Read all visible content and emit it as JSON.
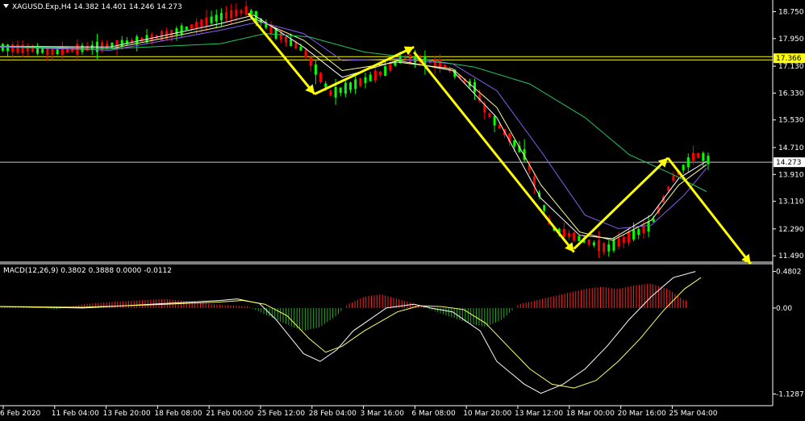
{
  "header": {
    "symbol_line": "XAGUSD.Exp,H4  14.382 14.401 14.246 14.273",
    "macd_line": "MACD(12,26,9) 0.3802 0.3888 0.0000 -0.0112"
  },
  "colors": {
    "background": "#000000",
    "bull_candle": "#00ff00",
    "bear_candle": "#ff0000",
    "arrow": "#ffff00",
    "ma_fast": "#ffffff",
    "ma_mid": "#ffff99",
    "ma_purple": "#8b5cf6",
    "ma_slow": "#22c55e",
    "macd_pos": "#ff2020",
    "macd_neg": "#22aa22",
    "level_line": "#c8c8c8",
    "hline_yellow": "#ffff00"
  },
  "chart_data": [
    {
      "type": "line",
      "title": "XAGUSD.Exp,H4",
      "ohlc_last": {
        "open": 14.382,
        "high": 14.401,
        "low": 14.246,
        "close": 14.273
      },
      "y_ticks": [
        "18.750",
        "17.950",
        "17.130",
        "16.330",
        "15.530",
        "14.710",
        "13.910",
        "13.110",
        "12.290",
        "11.490"
      ],
      "ylim": [
        11.35,
        19.05
      ],
      "x_ticks": [
        "6 Feb 2020",
        "11 Feb 04:00",
        "13 Feb 20:00",
        "18 Feb 08:00",
        "21 Feb 00:00",
        "25 Feb 12:00",
        "28 Feb 04:00",
        "3 Mar 16:00",
        "6 Mar 08:00",
        "10 Mar 20:00",
        "13 Mar 12:00",
        "18 Mar 00:00",
        "20 Mar 16:00",
        "25 Mar 04:00"
      ],
      "price_series": {
        "name": "Price",
        "x": [
          0,
          10,
          20,
          30,
          40,
          45,
          50,
          55,
          60,
          66,
          70,
          73,
          80,
          86,
          88,
          95,
          100,
          110,
          118,
          122,
          126,
          128,
          132,
          136,
          138,
          140
        ],
        "y": [
          17.7,
          17.55,
          17.75,
          18.05,
          18.6,
          18.8,
          18.1,
          17.6,
          16.3,
          16.7,
          17.0,
          17.4,
          17.2,
          16.5,
          15.8,
          14.5,
          12.3,
          11.7,
          12.4,
          13.8,
          14.5,
          14.4,
          13.6,
          12.7,
          12.0,
          11.4
        ]
      },
      "moving_averages": [
        {
          "color_key": "ma_fast",
          "x": [
            0,
            20,
            40,
            46,
            55,
            62,
            72,
            82,
            90,
            98,
            105,
            111,
            118,
            123,
            128
          ],
          "y": [
            17.72,
            17.7,
            18.4,
            18.65,
            17.7,
            16.8,
            17.3,
            17.0,
            15.6,
            13.2,
            12.1,
            12.0,
            12.7,
            13.8,
            14.3
          ]
        },
        {
          "color_key": "ma_mid",
          "x": [
            0,
            20,
            40,
            46,
            55,
            62,
            72,
            82,
            90,
            98,
            105,
            111,
            118,
            123,
            128
          ],
          "y": [
            17.7,
            17.65,
            18.3,
            18.55,
            17.9,
            17.0,
            17.25,
            17.05,
            15.9,
            13.6,
            12.2,
            11.95,
            12.55,
            13.6,
            14.2
          ]
        },
        {
          "color_key": "ma_purple",
          "x": [
            0,
            20,
            40,
            47,
            55,
            62,
            72,
            82,
            90,
            98,
            106,
            112,
            118,
            124,
            128
          ],
          "y": [
            17.7,
            17.6,
            18.2,
            18.45,
            18.1,
            17.3,
            17.35,
            17.2,
            16.4,
            14.6,
            12.7,
            12.3,
            12.4,
            13.3,
            14.1
          ]
        },
        {
          "color_key": "ma_slow",
          "x": [
            0,
            20,
            40,
            48,
            56,
            66,
            76,
            86,
            96,
            106,
            114,
            122,
            128
          ],
          "y": [
            17.72,
            17.65,
            17.8,
            18.1,
            18.0,
            17.55,
            17.35,
            17.1,
            16.6,
            15.6,
            14.5,
            13.9,
            13.4
          ]
        }
      ],
      "arrows": [
        {
          "x": [
            45,
            57
          ],
          "y": [
            18.7,
            16.3
          ]
        },
        {
          "x": [
            57,
            75
          ],
          "y": [
            16.3,
            17.7
          ]
        },
        {
          "x": [
            75,
            104
          ],
          "y": [
            17.55,
            11.6
          ]
        },
        {
          "x": [
            104,
            121
          ],
          "y": [
            11.7,
            14.4
          ]
        },
        {
          "x": [
            121,
            136
          ],
          "y": [
            14.4,
            11.25
          ]
        }
      ],
      "levels": [
        {
          "value": 17.366,
          "label": "17.366",
          "style": "double-yellow"
        },
        {
          "value": 14.273,
          "label": "14.273",
          "style": "grey"
        }
      ]
    },
    {
      "type": "bar",
      "title": "MACD(12,26,9)",
      "y_ticks": [
        "0.4802",
        "0.00",
        "-1.1287"
      ],
      "ylim": [
        -1.25,
        0.55
      ],
      "histogram": {
        "x": [
          0,
          5,
          10,
          15,
          20,
          25,
          30,
          35,
          40,
          43,
          45,
          47,
          50,
          53,
          55,
          58,
          61,
          63,
          66,
          69,
          72,
          75,
          78,
          81,
          85,
          88,
          91,
          94,
          97,
          100,
          103,
          106,
          109,
          112,
          115,
          118,
          121,
          124
        ],
        "values": [
          0.02,
          0.03,
          -0.02,
          0.05,
          0.08,
          0.1,
          0.12,
          0.08,
          0.04,
          0.03,
          0.02,
          -0.05,
          -0.15,
          -0.25,
          -0.3,
          -0.25,
          -0.1,
          0.05,
          0.15,
          0.18,
          0.12,
          0.06,
          -0.02,
          -0.1,
          -0.2,
          -0.25,
          -0.15,
          0.05,
          0.1,
          0.15,
          0.2,
          0.25,
          0.28,
          0.25,
          0.3,
          0.32,
          0.25,
          0.1
        ]
      },
      "macd_line": {
        "x": [
          0,
          15,
          30,
          40,
          43,
          47,
          50,
          55,
          58,
          61,
          64,
          70,
          75,
          78,
          82,
          87,
          90,
          95,
          98,
          102,
          106,
          110,
          114,
          118,
          122,
          126
        ],
        "y": [
          0.02,
          0.0,
          0.06,
          0.1,
          0.12,
          0.06,
          -0.15,
          -0.6,
          -0.7,
          -0.55,
          -0.3,
          0.0,
          0.05,
          0.0,
          -0.05,
          -0.3,
          -0.7,
          -1.0,
          -1.12,
          -1.0,
          -0.8,
          -0.5,
          -0.15,
          0.15,
          0.4,
          0.48
        ]
      },
      "signal_line": {
        "x": [
          0,
          15,
          30,
          40,
          44,
          48,
          52,
          56,
          59,
          62,
          66,
          72,
          76,
          80,
          84,
          88,
          92,
          96,
          100,
          104,
          108,
          112,
          116,
          120,
          124,
          127
        ],
        "y": [
          0.02,
          0.01,
          0.05,
          0.08,
          0.1,
          0.05,
          -0.1,
          -0.4,
          -0.58,
          -0.5,
          -0.3,
          -0.05,
          0.03,
          0.02,
          -0.02,
          -0.2,
          -0.5,
          -0.8,
          -1.0,
          -1.05,
          -0.95,
          -0.7,
          -0.4,
          -0.05,
          0.25,
          0.4
        ]
      }
    }
  ]
}
